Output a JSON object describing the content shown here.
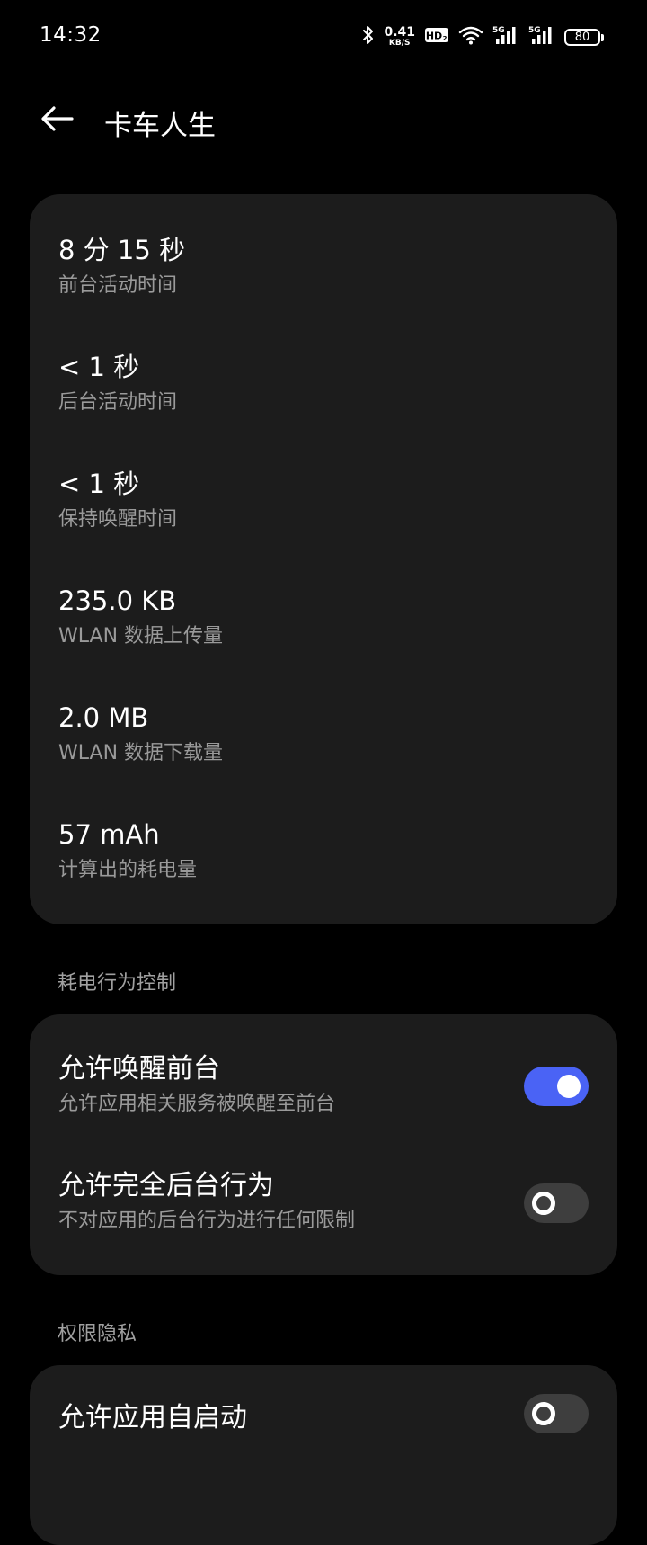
{
  "status_bar": {
    "time": "14:32",
    "net_speed_value": "0.41",
    "net_speed_unit": "KB/S",
    "hd_badge": "HD",
    "signal_1_label": "5G",
    "signal_2_label": "5G",
    "battery_level": "80",
    "icons": [
      "bluetooth-icon",
      "hd-voice-icon",
      "wifi-icon",
      "signal-icon",
      "signal-icon",
      "battery-icon"
    ]
  },
  "app_bar": {
    "title": "卡车人生",
    "back_icon": "arrow-left-icon"
  },
  "stats": [
    {
      "value": "8 分 15 秒",
      "label": "前台活动时间"
    },
    {
      "value": "< 1 秒",
      "label": "后台活动时间"
    },
    {
      "value": "< 1 秒",
      "label": "保持唤醒时间"
    },
    {
      "value": "235.0 KB",
      "label": "WLAN 数据上传量"
    },
    {
      "value": "2.0 MB",
      "label": "WLAN 数据下载量"
    },
    {
      "value": "57 mAh",
      "label": "计算出的耗电量"
    }
  ],
  "power_section": {
    "header": "耗电行为控制",
    "items": [
      {
        "title": "允许唤醒前台",
        "subtitle": "允许应用相关服务被唤醒至前台",
        "enabled": true
      },
      {
        "title": "允许完全后台行为",
        "subtitle": "不对应用的后台行为进行任何限制",
        "enabled": false
      }
    ]
  },
  "permission_section": {
    "header": "权限隐私",
    "items": [
      {
        "title": "允许应用自启动",
        "enabled": false
      }
    ]
  },
  "colors": {
    "background": "#000000",
    "card": "#1c1c1c",
    "accent": "#4a63f5",
    "secondary_text": "#9a9a9a"
  }
}
